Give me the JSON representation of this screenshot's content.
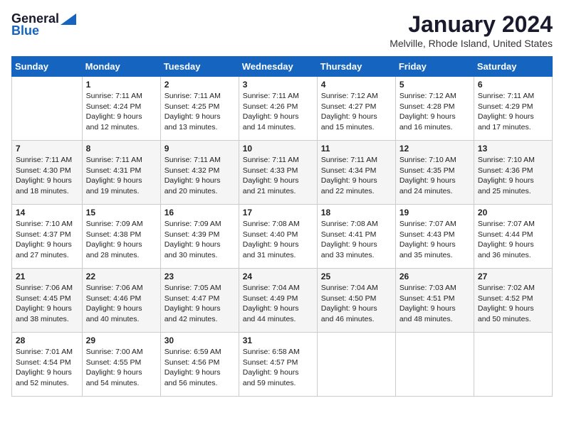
{
  "header": {
    "logo_line1": "General",
    "logo_line2": "Blue",
    "month_title": "January 2024",
    "location": "Melville, Rhode Island, United States"
  },
  "weekdays": [
    "Sunday",
    "Monday",
    "Tuesday",
    "Wednesday",
    "Thursday",
    "Friday",
    "Saturday"
  ],
  "weeks": [
    [
      {
        "num": "",
        "sunrise": "",
        "sunset": "",
        "daylight": ""
      },
      {
        "num": "1",
        "sunrise": "Sunrise: 7:11 AM",
        "sunset": "Sunset: 4:24 PM",
        "daylight": "Daylight: 9 hours and 12 minutes."
      },
      {
        "num": "2",
        "sunrise": "Sunrise: 7:11 AM",
        "sunset": "Sunset: 4:25 PM",
        "daylight": "Daylight: 9 hours and 13 minutes."
      },
      {
        "num": "3",
        "sunrise": "Sunrise: 7:11 AM",
        "sunset": "Sunset: 4:26 PM",
        "daylight": "Daylight: 9 hours and 14 minutes."
      },
      {
        "num": "4",
        "sunrise": "Sunrise: 7:12 AM",
        "sunset": "Sunset: 4:27 PM",
        "daylight": "Daylight: 9 hours and 15 minutes."
      },
      {
        "num": "5",
        "sunrise": "Sunrise: 7:12 AM",
        "sunset": "Sunset: 4:28 PM",
        "daylight": "Daylight: 9 hours and 16 minutes."
      },
      {
        "num": "6",
        "sunrise": "Sunrise: 7:11 AM",
        "sunset": "Sunset: 4:29 PM",
        "daylight": "Daylight: 9 hours and 17 minutes."
      }
    ],
    [
      {
        "num": "7",
        "sunrise": "Sunrise: 7:11 AM",
        "sunset": "Sunset: 4:30 PM",
        "daylight": "Daylight: 9 hours and 18 minutes."
      },
      {
        "num": "8",
        "sunrise": "Sunrise: 7:11 AM",
        "sunset": "Sunset: 4:31 PM",
        "daylight": "Daylight: 9 hours and 19 minutes."
      },
      {
        "num": "9",
        "sunrise": "Sunrise: 7:11 AM",
        "sunset": "Sunset: 4:32 PM",
        "daylight": "Daylight: 9 hours and 20 minutes."
      },
      {
        "num": "10",
        "sunrise": "Sunrise: 7:11 AM",
        "sunset": "Sunset: 4:33 PM",
        "daylight": "Daylight: 9 hours and 21 minutes."
      },
      {
        "num": "11",
        "sunrise": "Sunrise: 7:11 AM",
        "sunset": "Sunset: 4:34 PM",
        "daylight": "Daylight: 9 hours and 22 minutes."
      },
      {
        "num": "12",
        "sunrise": "Sunrise: 7:10 AM",
        "sunset": "Sunset: 4:35 PM",
        "daylight": "Daylight: 9 hours and 24 minutes."
      },
      {
        "num": "13",
        "sunrise": "Sunrise: 7:10 AM",
        "sunset": "Sunset: 4:36 PM",
        "daylight": "Daylight: 9 hours and 25 minutes."
      }
    ],
    [
      {
        "num": "14",
        "sunrise": "Sunrise: 7:10 AM",
        "sunset": "Sunset: 4:37 PM",
        "daylight": "Daylight: 9 hours and 27 minutes."
      },
      {
        "num": "15",
        "sunrise": "Sunrise: 7:09 AM",
        "sunset": "Sunset: 4:38 PM",
        "daylight": "Daylight: 9 hours and 28 minutes."
      },
      {
        "num": "16",
        "sunrise": "Sunrise: 7:09 AM",
        "sunset": "Sunset: 4:39 PM",
        "daylight": "Daylight: 9 hours and 30 minutes."
      },
      {
        "num": "17",
        "sunrise": "Sunrise: 7:08 AM",
        "sunset": "Sunset: 4:40 PM",
        "daylight": "Daylight: 9 hours and 31 minutes."
      },
      {
        "num": "18",
        "sunrise": "Sunrise: 7:08 AM",
        "sunset": "Sunset: 4:41 PM",
        "daylight": "Daylight: 9 hours and 33 minutes."
      },
      {
        "num": "19",
        "sunrise": "Sunrise: 7:07 AM",
        "sunset": "Sunset: 4:43 PM",
        "daylight": "Daylight: 9 hours and 35 minutes."
      },
      {
        "num": "20",
        "sunrise": "Sunrise: 7:07 AM",
        "sunset": "Sunset: 4:44 PM",
        "daylight": "Daylight: 9 hours and 36 minutes."
      }
    ],
    [
      {
        "num": "21",
        "sunrise": "Sunrise: 7:06 AM",
        "sunset": "Sunset: 4:45 PM",
        "daylight": "Daylight: 9 hours and 38 minutes."
      },
      {
        "num": "22",
        "sunrise": "Sunrise: 7:06 AM",
        "sunset": "Sunset: 4:46 PM",
        "daylight": "Daylight: 9 hours and 40 minutes."
      },
      {
        "num": "23",
        "sunrise": "Sunrise: 7:05 AM",
        "sunset": "Sunset: 4:47 PM",
        "daylight": "Daylight: 9 hours and 42 minutes."
      },
      {
        "num": "24",
        "sunrise": "Sunrise: 7:04 AM",
        "sunset": "Sunset: 4:49 PM",
        "daylight": "Daylight: 9 hours and 44 minutes."
      },
      {
        "num": "25",
        "sunrise": "Sunrise: 7:04 AM",
        "sunset": "Sunset: 4:50 PM",
        "daylight": "Daylight: 9 hours and 46 minutes."
      },
      {
        "num": "26",
        "sunrise": "Sunrise: 7:03 AM",
        "sunset": "Sunset: 4:51 PM",
        "daylight": "Daylight: 9 hours and 48 minutes."
      },
      {
        "num": "27",
        "sunrise": "Sunrise: 7:02 AM",
        "sunset": "Sunset: 4:52 PM",
        "daylight": "Daylight: 9 hours and 50 minutes."
      }
    ],
    [
      {
        "num": "28",
        "sunrise": "Sunrise: 7:01 AM",
        "sunset": "Sunset: 4:54 PM",
        "daylight": "Daylight: 9 hours and 52 minutes."
      },
      {
        "num": "29",
        "sunrise": "Sunrise: 7:00 AM",
        "sunset": "Sunset: 4:55 PM",
        "daylight": "Daylight: 9 hours and 54 minutes."
      },
      {
        "num": "30",
        "sunrise": "Sunrise: 6:59 AM",
        "sunset": "Sunset: 4:56 PM",
        "daylight": "Daylight: 9 hours and 56 minutes."
      },
      {
        "num": "31",
        "sunrise": "Sunrise: 6:58 AM",
        "sunset": "Sunset: 4:57 PM",
        "daylight": "Daylight: 9 hours and 59 minutes."
      },
      {
        "num": "",
        "sunrise": "",
        "sunset": "",
        "daylight": ""
      },
      {
        "num": "",
        "sunrise": "",
        "sunset": "",
        "daylight": ""
      },
      {
        "num": "",
        "sunrise": "",
        "sunset": "",
        "daylight": ""
      }
    ]
  ]
}
